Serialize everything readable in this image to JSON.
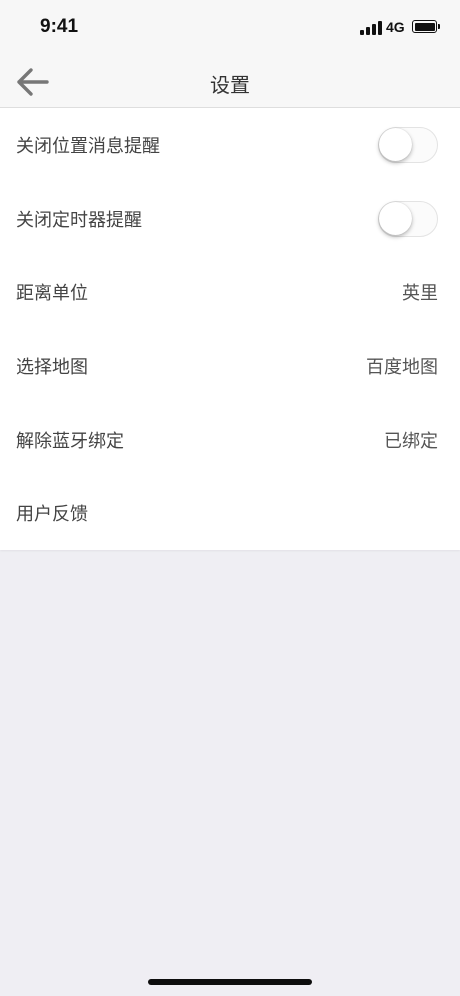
{
  "status_bar": {
    "time": "9:41",
    "network": "4G"
  },
  "nav": {
    "back_icon": "arrow-left-icon",
    "title": "设置"
  },
  "settings": [
    {
      "label": "关闭位置消息提醒",
      "type": "toggle",
      "on": false
    },
    {
      "label": "关闭定时器提醒",
      "type": "toggle",
      "on": false
    },
    {
      "label": "距离单位",
      "type": "value",
      "value": "英里"
    },
    {
      "label": "选择地图",
      "type": "value",
      "value": "百度地图"
    },
    {
      "label": "解除蓝牙绑定",
      "type": "value",
      "value": "已绑定"
    },
    {
      "label": "用户反馈",
      "type": "link"
    }
  ],
  "colors": {
    "background": "#efeef3",
    "bar": "#f7f7f7",
    "list": "#ffffff"
  }
}
